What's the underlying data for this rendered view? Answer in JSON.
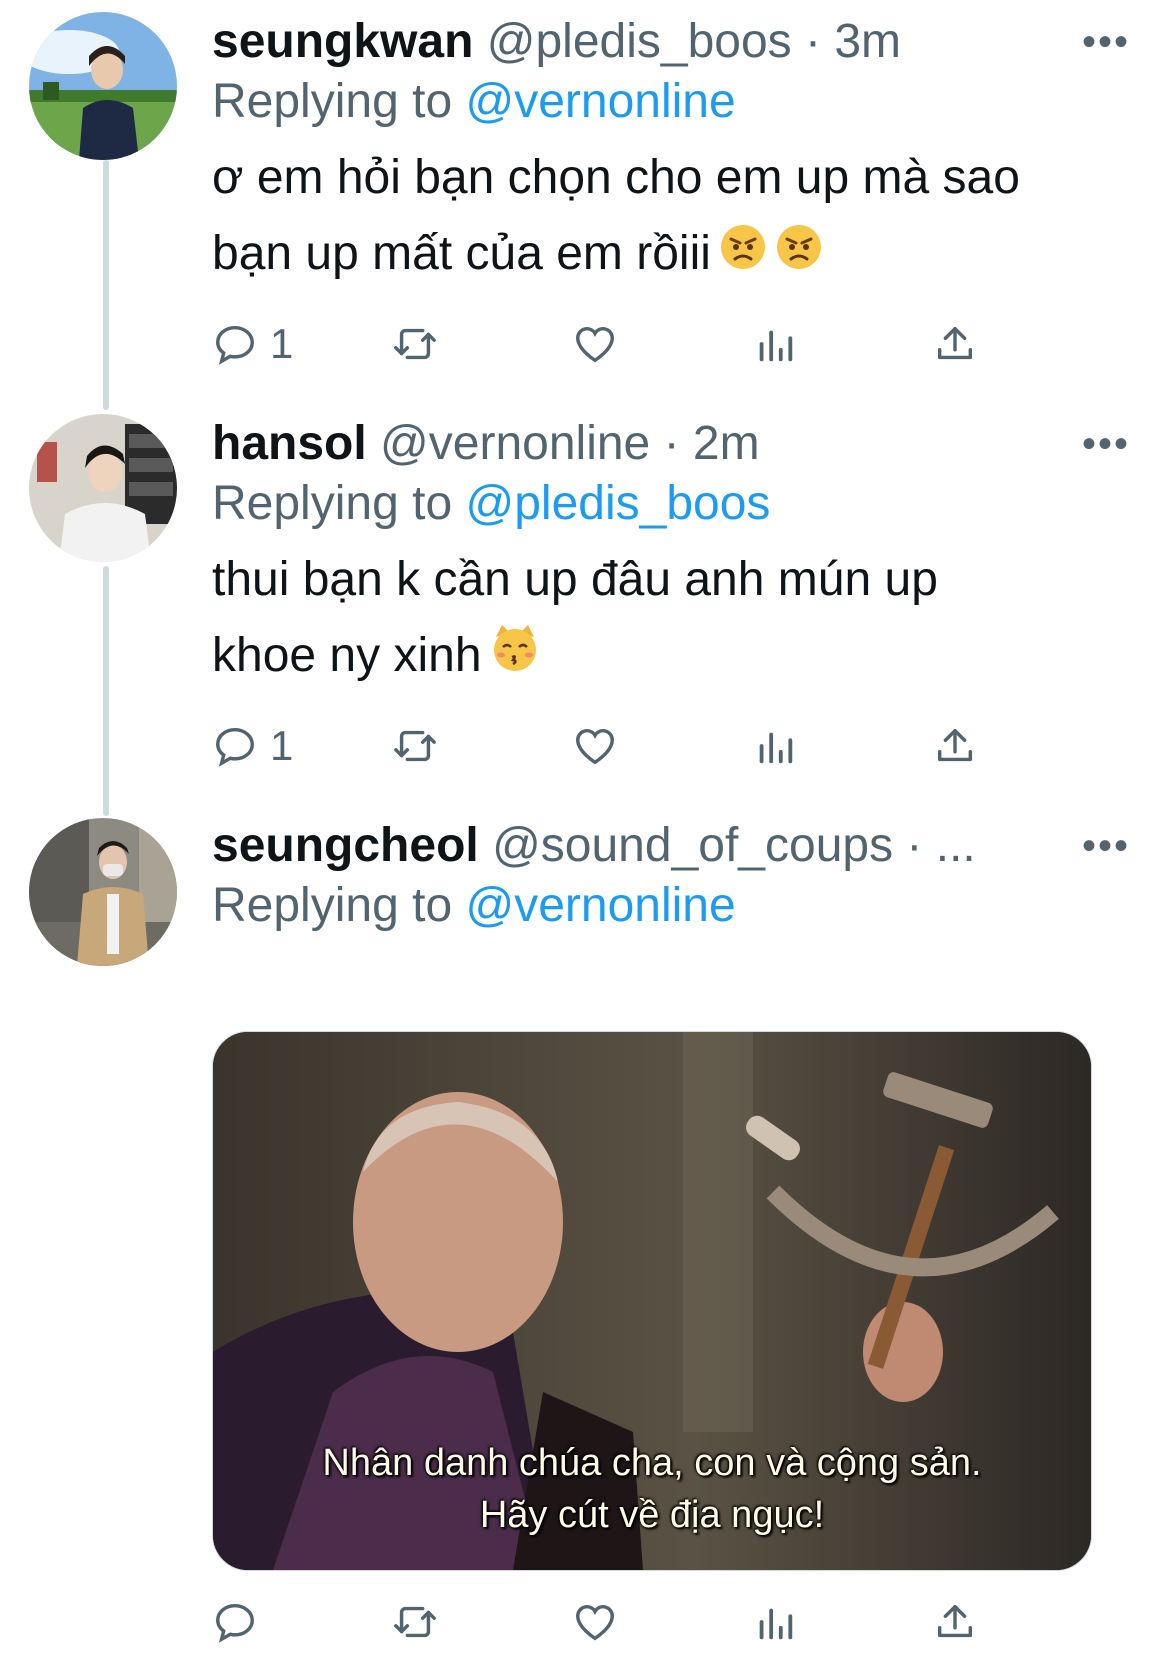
{
  "tweets": [
    {
      "name": "seungkwan",
      "handle": "@pledis_boos · 3m",
      "replying_prefix": "Replying to ",
      "replying_to": "@vernonline",
      "text_line1": "ơ em hỏi bạn chọn cho em up mà sao",
      "text_line2": "bạn up mất của em rồiii",
      "emoji": "angry-face-emoji",
      "reply_count": "1",
      "more": "•••"
    },
    {
      "name": "hansol",
      "handle": "@vernonline · 2m",
      "replying_prefix": "Replying to ",
      "replying_to": "@pledis_boos",
      "text_line1": "thui bạn k cần up đâu anh mún up",
      "text_line2": "khoe ny xinh",
      "emoji": "kissing-cat-emoji",
      "reply_count": "1",
      "more": "•••"
    },
    {
      "name": "seungcheol",
      "handle": "@sound_of_coups · ...",
      "replying_prefix": "Replying to ",
      "replying_to": "@vernonline",
      "media_caption_line1": "Nhân danh chúa cha, con và cộng sản.",
      "media_caption_line2": "Hãy cút về địa ngục!",
      "reply_count": "",
      "more": "•••"
    }
  ],
  "colors": {
    "link": "#1d9bf0",
    "secondary_text": "#536471",
    "thread_line": "#cfd9de",
    "primary_text": "#0f1419"
  },
  "icons": [
    "reply-icon",
    "retweet-icon",
    "like-icon",
    "views-icon",
    "share-icon",
    "more-icon"
  ]
}
